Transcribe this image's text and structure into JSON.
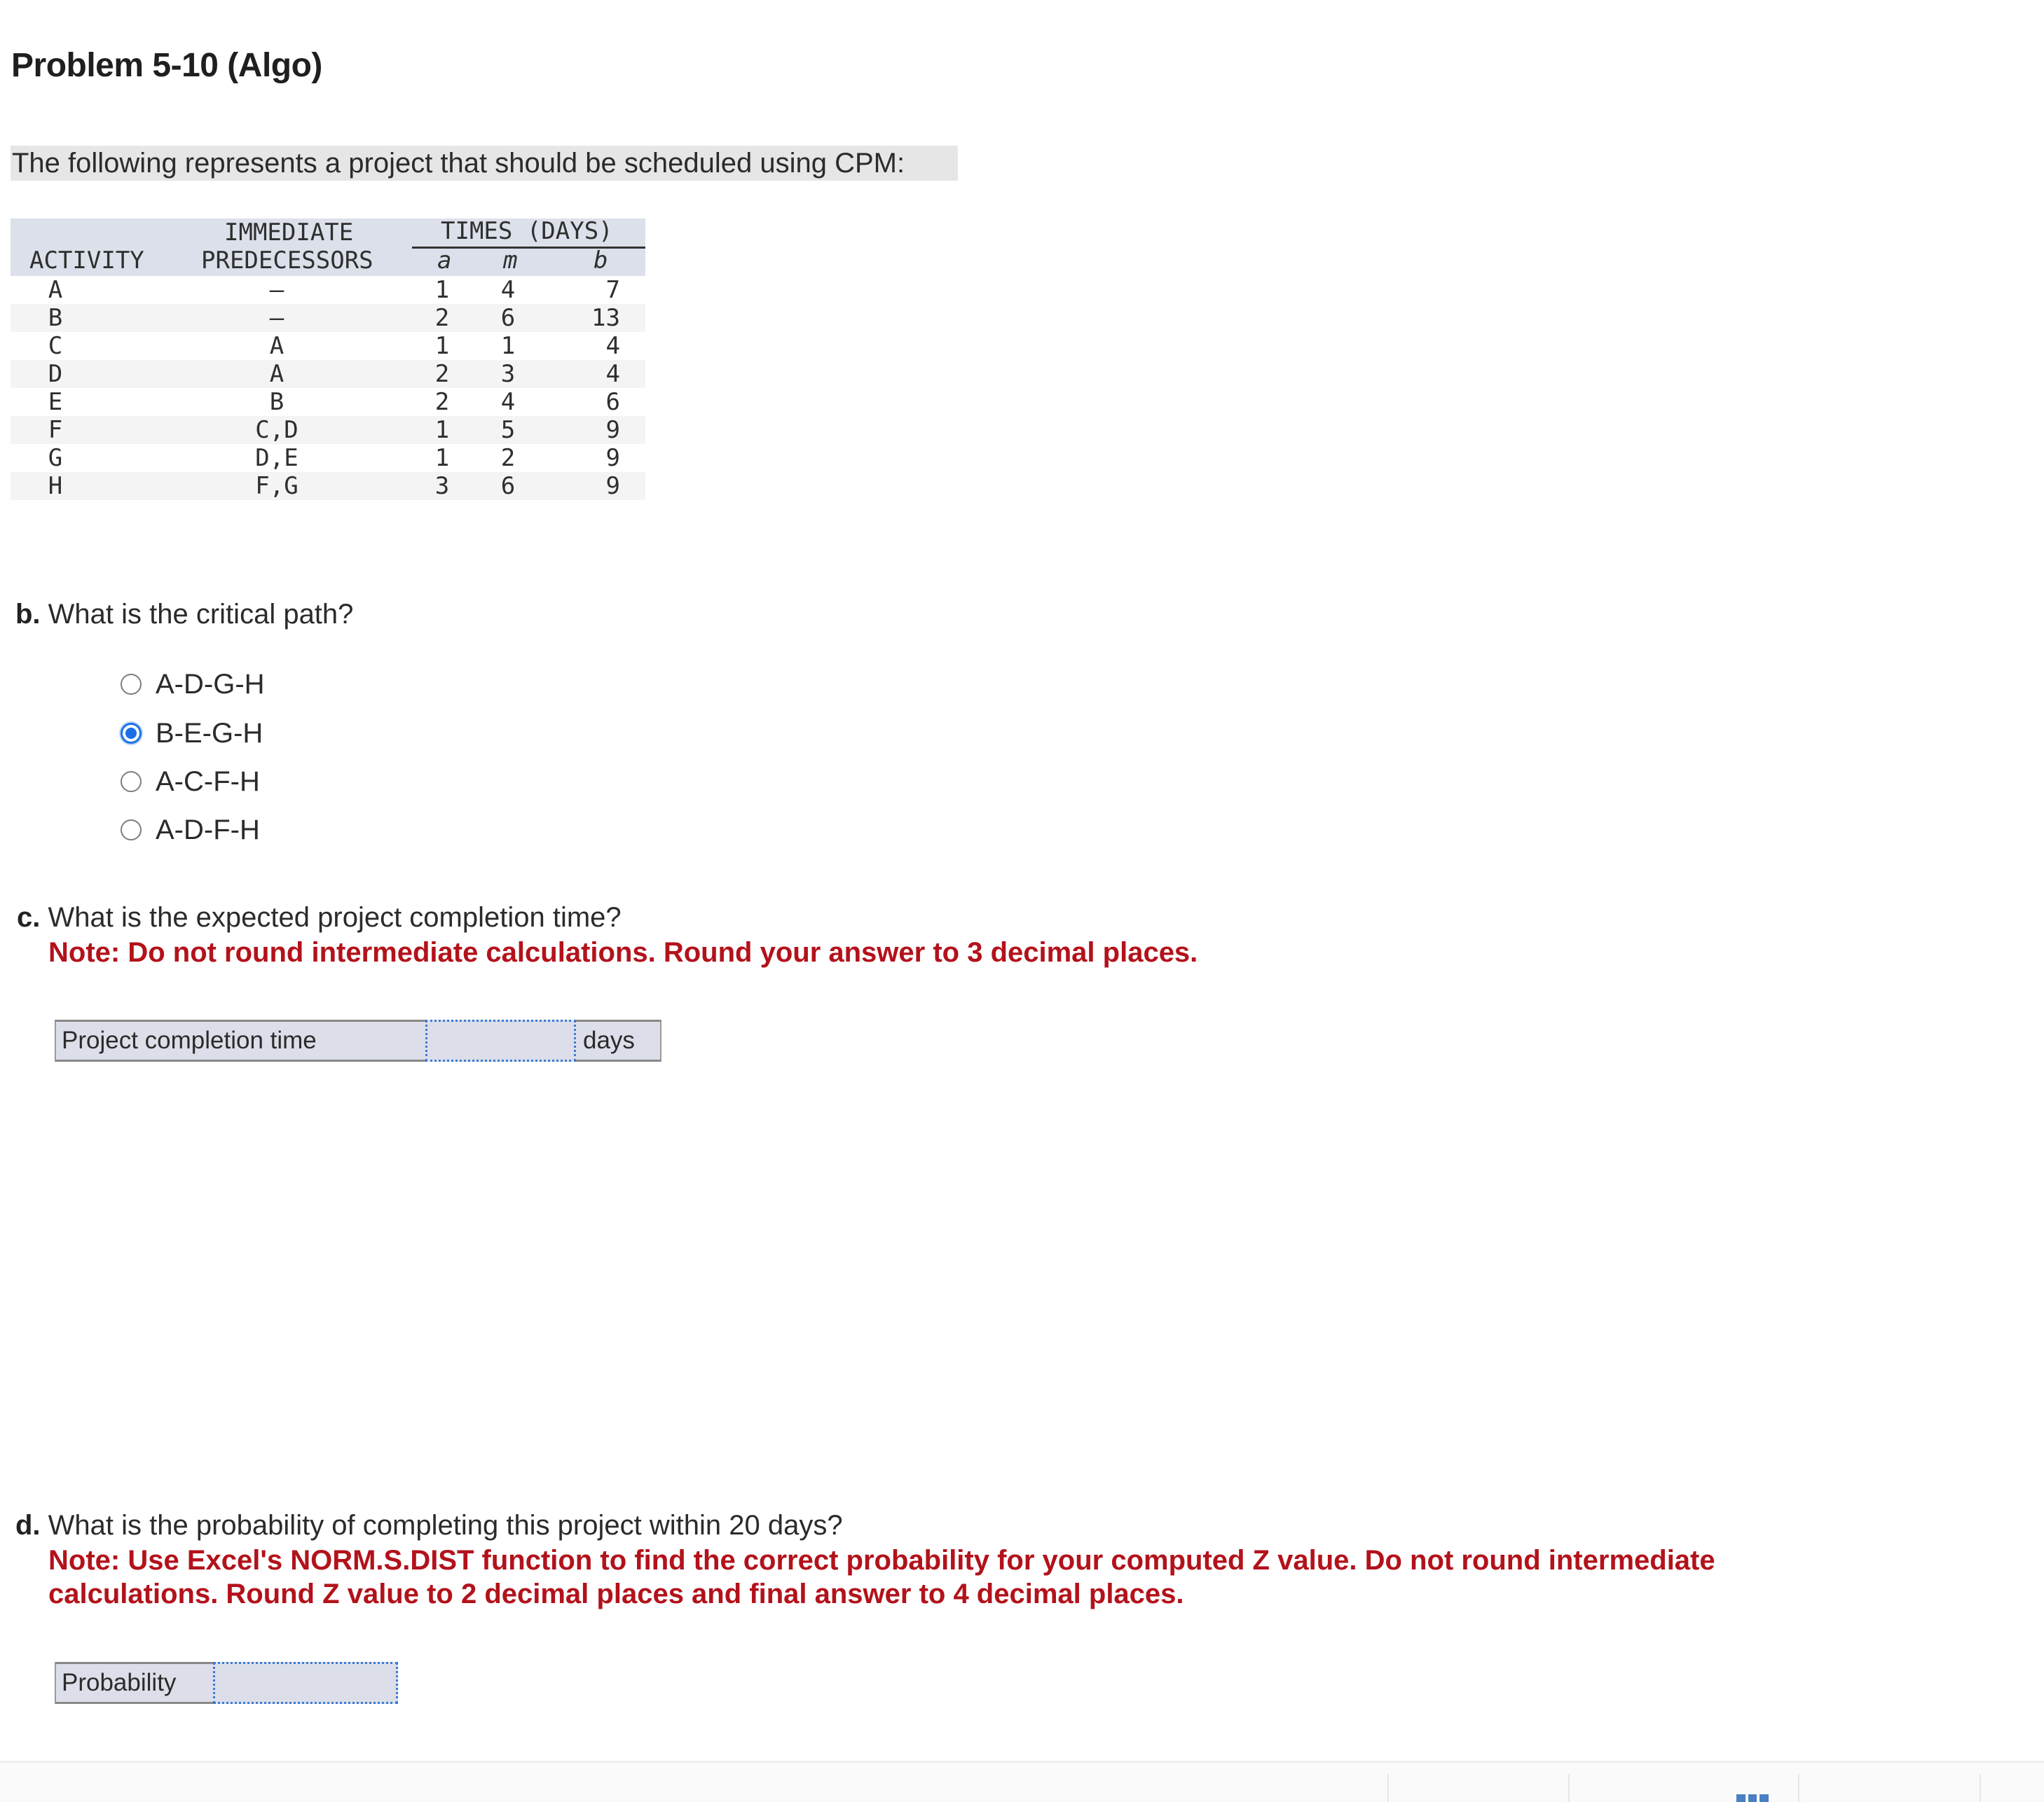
{
  "title": "Problem 5-10 (Algo)",
  "intro": "The following represents a project that should be scheduled using CPM:",
  "table": {
    "headers": {
      "activity": "ACTIVITY",
      "predecessors_line1": "IMMEDIATE",
      "predecessors_line2": "PREDECESSORS",
      "times": "TIMES (DAYS)",
      "a": "a",
      "m": "m",
      "b": "b"
    },
    "rows": [
      {
        "activity": "A",
        "pred": "—",
        "a": "1",
        "m": "4",
        "b": "7"
      },
      {
        "activity": "B",
        "pred": "—",
        "a": "2",
        "m": "6",
        "b": "13"
      },
      {
        "activity": "C",
        "pred": "A",
        "a": "1",
        "m": "1",
        "b": "4"
      },
      {
        "activity": "D",
        "pred": "A",
        "a": "2",
        "m": "3",
        "b": "4"
      },
      {
        "activity": "E",
        "pred": "B",
        "a": "2",
        "m": "4",
        "b": "6"
      },
      {
        "activity": "F",
        "pred": "C,D",
        "a": "1",
        "m": "5",
        "b": "9"
      },
      {
        "activity": "G",
        "pred": "D,E",
        "a": "1",
        "m": "2",
        "b": "9"
      },
      {
        "activity": "H",
        "pred": "F,G",
        "a": "3",
        "m": "6",
        "b": "9"
      }
    ]
  },
  "part_b": {
    "letter": "b.",
    "question": "What is the critical path?",
    "options": [
      "A-D-G-H",
      "B-E-G-H",
      "A-C-F-H",
      "A-D-F-H"
    ],
    "selected": "B-E-G-H"
  },
  "part_c": {
    "letter": "c.",
    "question": "What is the expected project completion time?",
    "note": "Note: Do not round intermediate calculations. Round your answer to 3 decimal places.",
    "field_label": "Project completion time",
    "field_value": "",
    "unit": "days"
  },
  "part_d": {
    "letter": "d.",
    "question": "What is the probability of completing this project within 20 days?",
    "note_line1": "Note: Use Excel's NORM.S.DIST function to find the correct probability for your computed Z value. Do not round intermediate",
    "note_line2": "calculations. Round Z value to 2 decimal places and final answer to 4 decimal places.",
    "field_label": "Probability",
    "field_value": ""
  },
  "colors": {
    "note_red": "#b3121b",
    "radio_selected": "#1a6fe8",
    "table_header_bg": "#dbe0ea",
    "answer_row_bg": "#dcdfe9",
    "field_border": "#3b7bd6"
  }
}
